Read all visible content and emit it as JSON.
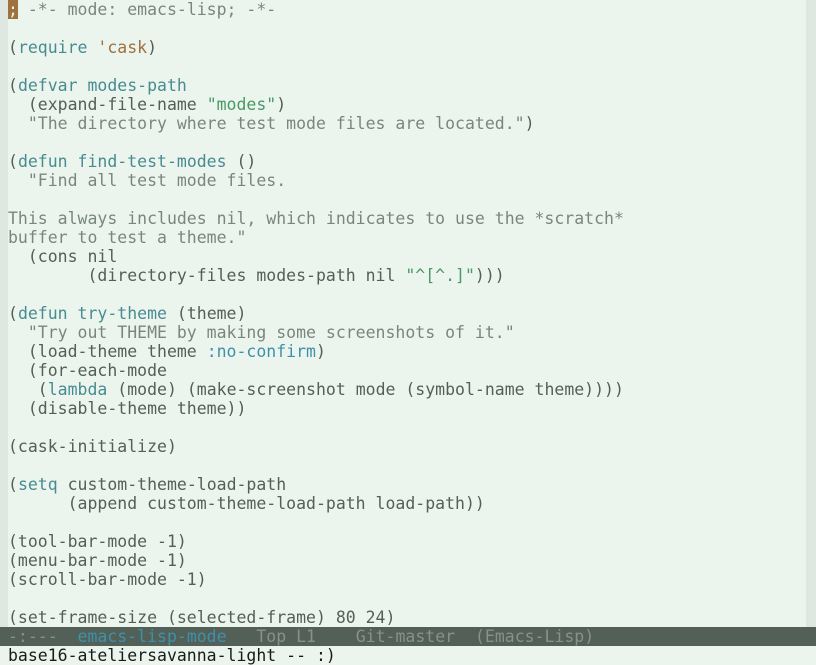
{
  "editor": {
    "lines": [
      [
        {
          "t": "; -*- mode: emacs-lisp; -*-",
          "c": "comment",
          "cursor_first": true
        }
      ],
      [],
      [
        {
          "t": "(",
          "c": "paren"
        },
        {
          "t": "require",
          "c": "keyword"
        },
        {
          "t": " ",
          "c": "plain"
        },
        {
          "t": "'cask",
          "c": "quote"
        },
        {
          "t": ")",
          "c": "paren"
        }
      ],
      [],
      [
        {
          "t": "(",
          "c": "paren"
        },
        {
          "t": "defvar",
          "c": "keyword"
        },
        {
          "t": " ",
          "c": "plain"
        },
        {
          "t": "modes-path",
          "c": "var"
        }
      ],
      [
        {
          "t": "  (expand-file-name ",
          "c": "plain"
        },
        {
          "t": "\"modes\"",
          "c": "string"
        },
        {
          "t": ")",
          "c": "paren"
        }
      ],
      [
        {
          "t": "  \"The directory where test mode files are located.\"",
          "c": "doc"
        },
        {
          "t": ")",
          "c": "paren"
        }
      ],
      [],
      [
        {
          "t": "(",
          "c": "paren"
        },
        {
          "t": "defun",
          "c": "keyword"
        },
        {
          "t": " ",
          "c": "plain"
        },
        {
          "t": "find-test-modes",
          "c": "func"
        },
        {
          "t": " ()",
          "c": "plain"
        }
      ],
      [
        {
          "t": "  \"Find all test mode files.",
          "c": "doc"
        }
      ],
      [],
      [
        {
          "t": "This always includes nil, which indicates to use the *scratch*",
          "c": "doc"
        }
      ],
      [
        {
          "t": "buffer to test a theme.\"",
          "c": "doc"
        }
      ],
      [
        {
          "t": "  (cons nil",
          "c": "plain"
        }
      ],
      [
        {
          "t": "        (directory-files modes-path nil ",
          "c": "plain"
        },
        {
          "t": "\"^[^.]\"",
          "c": "string"
        },
        {
          "t": ")))",
          "c": "paren"
        }
      ],
      [],
      [
        {
          "t": "(",
          "c": "paren"
        },
        {
          "t": "defun",
          "c": "keyword"
        },
        {
          "t": " ",
          "c": "plain"
        },
        {
          "t": "try-theme",
          "c": "func"
        },
        {
          "t": " (theme)",
          "c": "plain"
        }
      ],
      [
        {
          "t": "  \"Try out THEME by making some screenshots of it.\"",
          "c": "doc"
        }
      ],
      [
        {
          "t": "  (load-theme theme ",
          "c": "plain"
        },
        {
          "t": ":no-confirm",
          "c": "const"
        },
        {
          "t": ")",
          "c": "paren"
        }
      ],
      [
        {
          "t": "  (for-each-mode",
          "c": "plain"
        }
      ],
      [
        {
          "t": "   (",
          "c": "plain"
        },
        {
          "t": "lambda",
          "c": "keyword"
        },
        {
          "t": " (mode) (make-screenshot mode (symbol-name theme))))",
          "c": "plain"
        }
      ],
      [
        {
          "t": "  (disable-theme theme))",
          "c": "plain"
        }
      ],
      [],
      [
        {
          "t": "(cask-initialize)",
          "c": "plain"
        }
      ],
      [],
      [
        {
          "t": "(",
          "c": "paren"
        },
        {
          "t": "setq",
          "c": "keyword"
        },
        {
          "t": " custom-theme-load-path",
          "c": "plain"
        }
      ],
      [
        {
          "t": "      (append custom-theme-load-path load-path))",
          "c": "plain"
        }
      ],
      [],
      [
        {
          "t": "(tool-bar-mode -1)",
          "c": "plain"
        }
      ],
      [
        {
          "t": "(menu-bar-mode -1)",
          "c": "plain"
        }
      ],
      [
        {
          "t": "(scroll-bar-mode -1)",
          "c": "plain"
        }
      ],
      [],
      [
        {
          "t": "(set-frame-size (selected-frame) 80 24)",
          "c": "plain"
        }
      ]
    ]
  },
  "modeline": {
    "status": "-:---",
    "buffer_name": "emacs-lisp-mode",
    "position": "Top L1",
    "vc": "Git-master",
    "major_mode": "(Emacs-Lisp)"
  },
  "minibuffer": {
    "message": "base16-ateliersavanna-light -- :)"
  },
  "colors": {
    "background": "#ecf4ee",
    "fringe": "#dfe7e2",
    "foreground": "#526057",
    "comment": "#78877d",
    "keyword": "#478c90",
    "string": "#489963",
    "constant": "#3e91ac",
    "quote": "#9f713c",
    "cursor": "#9f713c",
    "modeline_bg": "#526057"
  }
}
